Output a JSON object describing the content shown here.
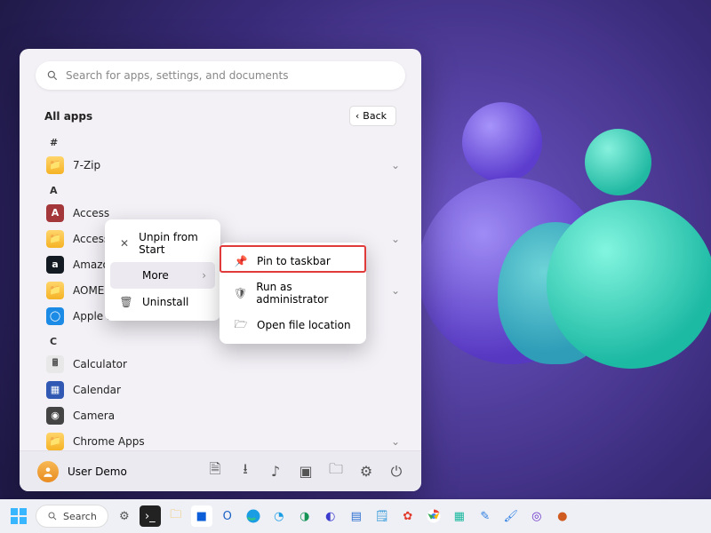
{
  "search": {
    "placeholder": "Search for apps, settings, and documents"
  },
  "header": {
    "title": "All apps",
    "back": "Back"
  },
  "letters": {
    "hash": "#",
    "a": "A",
    "c": "C"
  },
  "apps": {
    "hash": [
      {
        "label": "7-Zip",
        "icon": "fld",
        "expand": true
      }
    ],
    "a": [
      {
        "label": "Access",
        "icon": "acc"
      },
      {
        "label": "Accessibility",
        "icon": "fld",
        "expand": true
      },
      {
        "label": "Amazon Photos",
        "icon": "amz"
      },
      {
        "label": "AOMEI Partition Assistant",
        "icon": "fld",
        "expand": true
      },
      {
        "label": "Apple Devices",
        "icon": "apl"
      }
    ],
    "c": [
      {
        "label": "Calculator",
        "icon": "calc"
      },
      {
        "label": "Calendar",
        "icon": "cal"
      },
      {
        "label": "Camera",
        "icon": "cam"
      },
      {
        "label": "Chrome Apps",
        "icon": "fld",
        "expand": true
      }
    ]
  },
  "ctx1": {
    "unpin": "Unpin from Start",
    "more": "More",
    "uninstall": "Uninstall"
  },
  "ctx2": {
    "pin": "Pin to taskbar",
    "admin": "Run as administrator",
    "open": "Open file location"
  },
  "footer": {
    "user": "User Demo"
  },
  "taskbar": {
    "search": "Search"
  }
}
